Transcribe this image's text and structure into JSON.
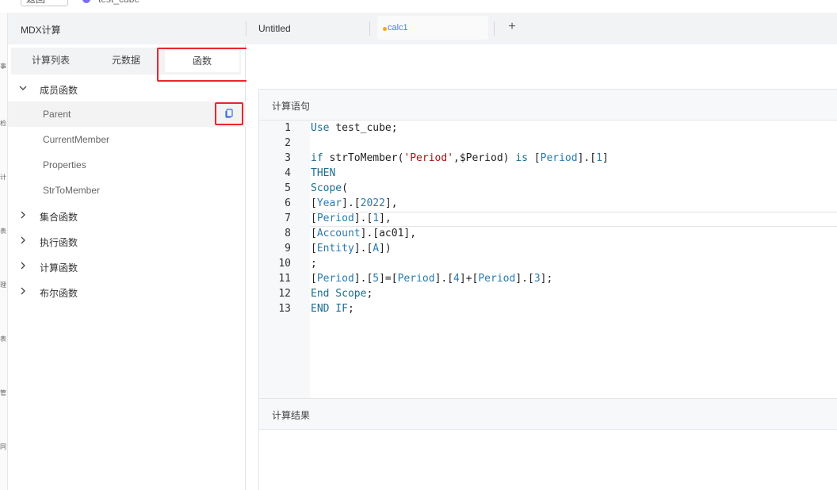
{
  "top": {
    "back_label": "返回",
    "cube_name": "test_cube"
  },
  "app_nav": {
    "glyphs": [
      "事",
      "检",
      "计",
      "表",
      "理",
      "表",
      "管",
      "同"
    ]
  },
  "header": {
    "title": "MDX计算",
    "tabs": [
      {
        "label": "Untitled",
        "modified": false
      },
      {
        "label": "calc1",
        "modified": true
      }
    ],
    "add_tab_symbol": "+"
  },
  "left_panel": {
    "tabs": [
      {
        "label": "计算列表",
        "active": false
      },
      {
        "label": "元数据",
        "active": false
      },
      {
        "label": "函数",
        "active": true
      }
    ],
    "groups": [
      {
        "label": "成员函数",
        "expanded": true,
        "items": [
          "Parent",
          "CurrentMember",
          "Properties",
          "StrToMember"
        ]
      },
      {
        "label": "集合函数",
        "expanded": false
      },
      {
        "label": "执行函数",
        "expanded": false
      },
      {
        "label": "计算函数",
        "expanded": false
      },
      {
        "label": "布尔函数",
        "expanded": false
      }
    ],
    "hovered_item": "Parent"
  },
  "editor": {
    "section_title": "计算语句",
    "current_line": 7,
    "lines": [
      [
        [
          "k",
          "Use"
        ],
        [
          "t",
          " test_cube;"
        ]
      ],
      [],
      [
        [
          "k",
          "if"
        ],
        [
          "t",
          " strToMember("
        ],
        [
          "s",
          "'Period'"
        ],
        [
          "t",
          ",$Period) "
        ],
        [
          "k",
          "is"
        ],
        [
          "t",
          " ["
        ],
        [
          "b",
          "Period"
        ],
        [
          "t",
          "].["
        ],
        [
          "b",
          "1"
        ],
        [
          "t",
          "]"
        ]
      ],
      [
        [
          "k",
          "THEN"
        ]
      ],
      [
        [
          "k",
          "Scope"
        ],
        [
          "t",
          "("
        ]
      ],
      [
        [
          "t",
          "["
        ],
        [
          "b",
          "Year"
        ],
        [
          "t",
          "].["
        ],
        [
          "b",
          "2022"
        ],
        [
          "t",
          "],"
        ]
      ],
      [
        [
          "t",
          "["
        ],
        [
          "b",
          "Period"
        ],
        [
          "t",
          "].["
        ],
        [
          "b",
          "1"
        ],
        [
          "t",
          "],"
        ]
      ],
      [
        [
          "t",
          "["
        ],
        [
          "b",
          "Account"
        ],
        [
          "t",
          "].[ac01],"
        ]
      ],
      [
        [
          "t",
          "["
        ],
        [
          "b",
          "Entity"
        ],
        [
          "t",
          "].["
        ],
        [
          "b",
          "A"
        ],
        [
          "t",
          "])"
        ]
      ],
      [
        [
          "t",
          ";"
        ]
      ],
      [
        [
          "t",
          "["
        ],
        [
          "b",
          "Period"
        ],
        [
          "t",
          "].["
        ],
        [
          "b",
          "5"
        ],
        [
          "t",
          "]=["
        ],
        [
          "b",
          "Period"
        ],
        [
          "t",
          "].["
        ],
        [
          "b",
          "4"
        ],
        [
          "t",
          "]+["
        ],
        [
          "b",
          "Period"
        ],
        [
          "t",
          "].["
        ],
        [
          "b",
          "3"
        ],
        [
          "t",
          "];"
        ]
      ],
      [
        [
          "k",
          "End Scope"
        ],
        [
          "t",
          ";"
        ]
      ],
      [
        [
          "k",
          "END IF"
        ],
        [
          "t",
          ";"
        ]
      ]
    ]
  },
  "result": {
    "section_title": "计算结果"
  },
  "colors": {
    "highlight_box": "#e8262d",
    "accent": "#4a7cf6",
    "modified_dot": "#f5a623"
  }
}
